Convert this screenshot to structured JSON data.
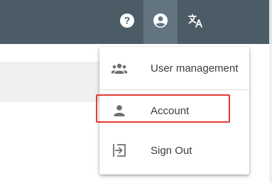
{
  "topbar": {
    "buttons": [
      {
        "name": "help",
        "icon": "help-circle-icon"
      },
      {
        "name": "account",
        "icon": "account-circle-icon",
        "active": true
      },
      {
        "name": "language",
        "icon": "translate-icon"
      }
    ]
  },
  "menu": {
    "items": [
      {
        "label": "User management",
        "icon": "group-icon"
      },
      {
        "label": "Account",
        "icon": "person-icon",
        "highlighted": true
      },
      {
        "label": "Sign Out",
        "icon": "sign-out-icon"
      }
    ]
  },
  "colors": {
    "topbar": "#4b5c66",
    "active_button": "#627480",
    "icon_white": "#ffffff",
    "menu_icon": "#6e6e6e",
    "menu_text": "#3c3c3c",
    "highlight_border": "#e53935"
  }
}
